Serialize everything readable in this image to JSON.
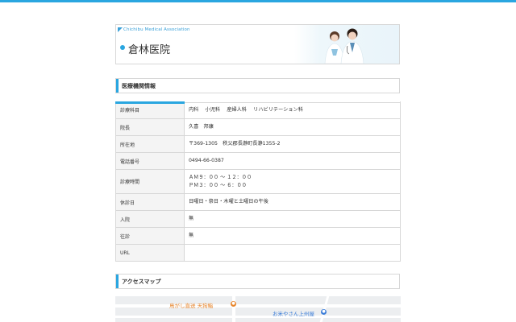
{
  "header": {
    "association": "Chichibu Medical Association",
    "hospital_name": "倉林医院"
  },
  "sections": {
    "info_title": "医療機関情報",
    "map_title": "アクセスマップ"
  },
  "info_rows": [
    {
      "label": "診療科目",
      "value": "内科　 小児科　 産婦人科　 リハビリテーション科"
    },
    {
      "label": "院長",
      "value": "久喜　邦康"
    },
    {
      "label": "所在地",
      "value": "〒369-1305　秩父郡長瀞町長瀞1355-2"
    },
    {
      "label": "電話番号",
      "value": "0494-66-0387"
    },
    {
      "label": "診療時間",
      "value": "ＡＭ９：００ ～ １２：００\nＰＭ３：００ ～ ６：００"
    },
    {
      "label": "休診日",
      "value": "日曜日・祭日・木曜と土曜日の午後"
    },
    {
      "label": "入院",
      "value": "無"
    },
    {
      "label": "往診",
      "value": "無"
    },
    {
      "label": "URL",
      "value": ""
    }
  ],
  "map": {
    "poi_1": "鳥がし直送 天狗鮨",
    "poi_2": "お米やさん上州屋"
  },
  "colors": {
    "accent": "#2aa6e0",
    "poi_orange": "#e8862c",
    "poi_blue": "#3b7dd8"
  }
}
